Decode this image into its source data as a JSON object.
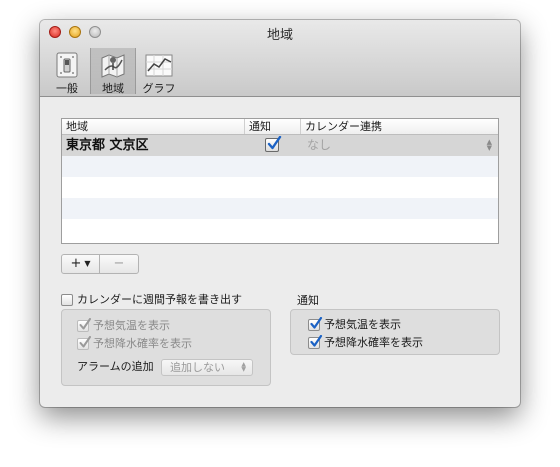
{
  "window": {
    "title": "地域"
  },
  "toolbar": {
    "items": [
      {
        "label": "一般"
      },
      {
        "label": "地域"
      },
      {
        "label": "グラフ"
      }
    ]
  },
  "table": {
    "columns": [
      "地域",
      "通知",
      "カレンダー連携"
    ],
    "rows": [
      {
        "region": "東京都 文京区",
        "notify": true,
        "calendar": "なし"
      }
    ]
  },
  "controls": {
    "add_label": "+",
    "add_arrow": "▼",
    "remove_label": "−"
  },
  "calendar_export": {
    "label": "カレンダーに週間予報を書き出す",
    "checked": false,
    "show_temp_label": "予想気温を表示",
    "show_rain_label": "予想降水確率を表示",
    "alarm_label": "アラームの追加",
    "alarm_value": "追加しない"
  },
  "notification": {
    "title": "通知",
    "show_temp_label": "予想気温を表示",
    "show_rain_label": "予想降水確率を表示"
  },
  "colors": {
    "check_blue": "#1b62c5",
    "selected_row": "#d6d6d6"
  }
}
